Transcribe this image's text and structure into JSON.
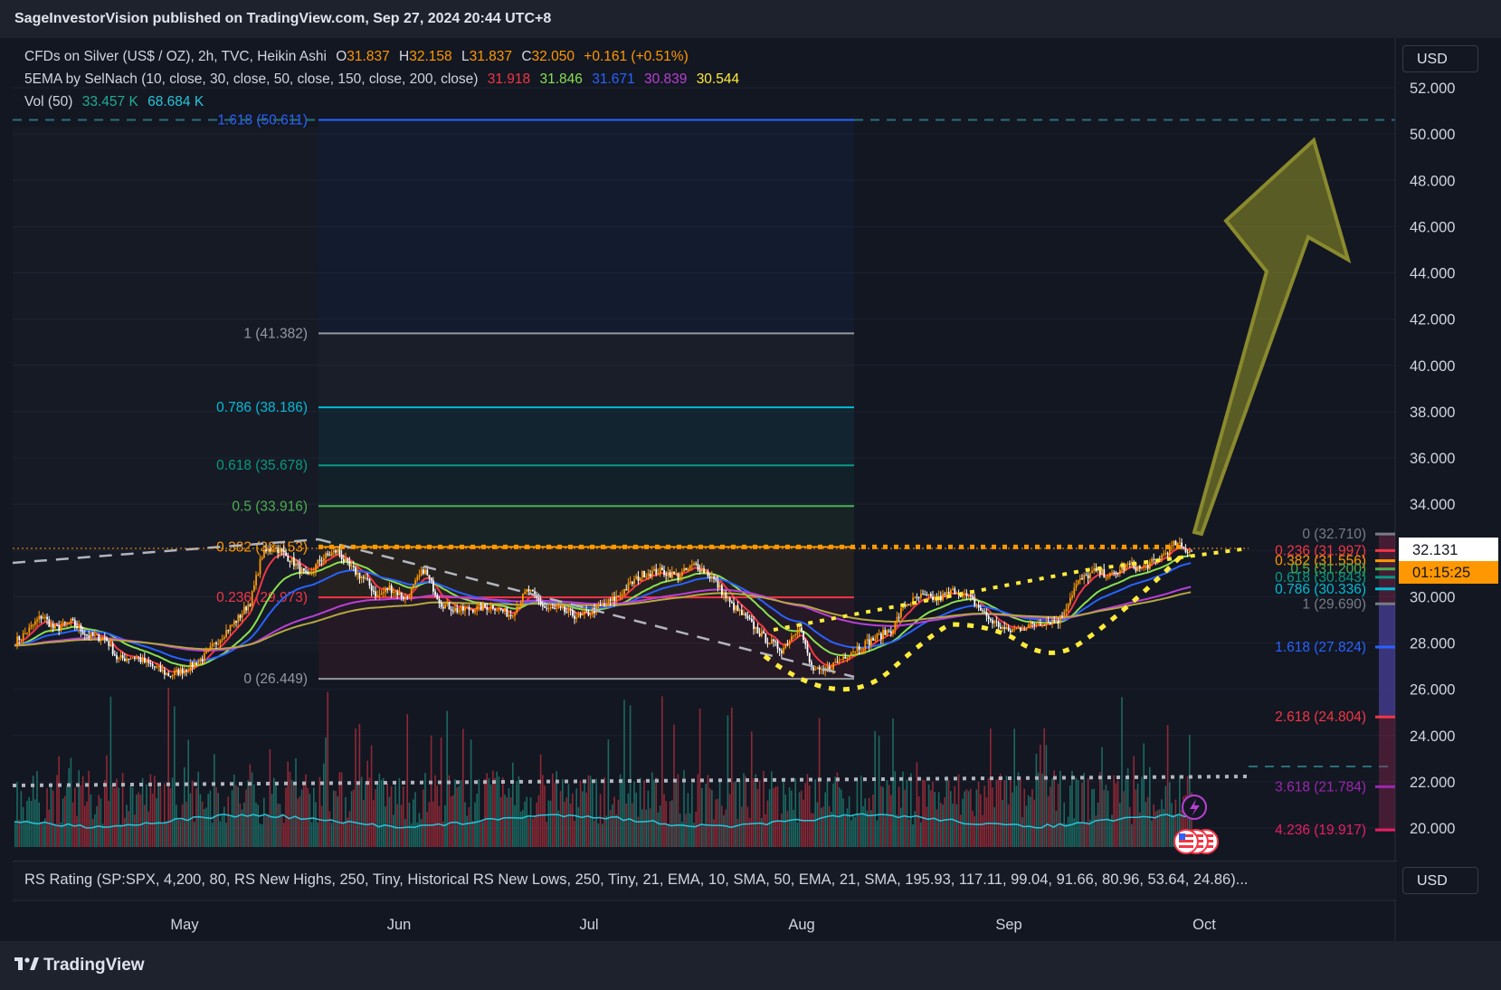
{
  "header": {
    "publisher": "SageInvestorVision published on TradingView.com, Sep 27, 2024 20:44 UTC+8"
  },
  "legend": {
    "symbol_line": "CFDs on Silver (US$ / OZ), 2h, TVC, Heikin Ashi",
    "ohlc": [
      {
        "label": "O",
        "value": "31.837"
      },
      {
        "label": "H",
        "value": "32.158"
      },
      {
        "label": "L",
        "value": "31.837"
      },
      {
        "label": "C",
        "value": "32.050"
      }
    ],
    "change": "+0.161 (+0.51%)",
    "ema_line": "5EMA by SelNach (10, close, 30, close, 50, close, 150, close, 200, close)",
    "ema_values": [
      {
        "value": "31.918",
        "color": "#f23645"
      },
      {
        "value": "31.846",
        "color": "#89e051"
      },
      {
        "value": "31.671",
        "color": "#2962ff"
      },
      {
        "value": "30.839",
        "color": "#ba3fd6"
      },
      {
        "value": "30.544",
        "color": "#ffeb3b"
      }
    ],
    "vol_line": "Vol (50)",
    "vol_values": [
      {
        "value": "33.457 K",
        "color": "#22ab94"
      },
      {
        "value": "68.684 K",
        "color": "#26c6da"
      }
    ]
  },
  "currency_top": "USD",
  "currency_bottom": "USD",
  "rs_rating": "RS Rating (SP:SPX, 4,200, 80, RS New Highs, 250, Tiny, Historical RS New Lows, 250, Tiny, 21, EMA, 10, SMA, 50, EMA, 21, SMA, 195.93, 117.11, 99.04, 91.66, 80.96, 53.64, 24.86)...",
  "footer": {
    "brand": "TradingView"
  },
  "colors": {
    "background": "#131722",
    "up": "#ff9800",
    "down": "#ffffff",
    "accent_arrow": "#8a8a2e"
  },
  "chart_data": {
    "type": "candlestick",
    "symbol": "CFDs on Silver (US$ / OZ)",
    "interval": "2h",
    "ylim": [
      19.2,
      53.2
    ],
    "y_ticks": [
      "52.000",
      "50.000",
      "48.000",
      "46.000",
      "44.000",
      "42.000",
      "40.000",
      "38.000",
      "36.000",
      "34.000",
      "32.000",
      "30.000",
      "28.000",
      "26.000",
      "24.000",
      "22.000",
      "20.000"
    ],
    "x_labels": [
      "May",
      "Jun",
      "Jul",
      "Aug",
      "Sep",
      "Oct"
    ],
    "price_path": [
      [
        "2024-04-24",
        27.8
      ],
      [
        "2024-04-27",
        28.4
      ],
      [
        "2024-04-30",
        29.2
      ],
      [
        "2024-05-02",
        28.6
      ],
      [
        "2024-05-05",
        28.9
      ],
      [
        "2024-05-08",
        28.3
      ],
      [
        "2024-05-11",
        28.2
      ],
      [
        "2024-05-13",
        27.3
      ],
      [
        "2024-05-16",
        27.4
      ],
      [
        "2024-05-19",
        27.0
      ],
      [
        "2024-05-22",
        26.6
      ],
      [
        "2024-05-25",
        26.9
      ],
      [
        "2024-05-28",
        27.4
      ],
      [
        "2024-05-31",
        28.3
      ],
      [
        "2024-06-03",
        29.1
      ],
      [
        "2024-06-05",
        29.8
      ],
      [
        "2024-06-07",
        31.8
      ],
      [
        "2024-06-09",
        32.2
      ],
      [
        "2024-06-12",
        31.6
      ],
      [
        "2024-06-15",
        30.8
      ],
      [
        "2024-06-17",
        31.6
      ],
      [
        "2024-06-20",
        32.0
      ],
      [
        "2024-06-22",
        31.3
      ],
      [
        "2024-06-25",
        30.7
      ],
      [
        "2024-06-27",
        30.0
      ],
      [
        "2024-06-29",
        30.4
      ],
      [
        "2024-07-02",
        29.9
      ],
      [
        "2024-07-05",
        31.2
      ],
      [
        "2024-07-08",
        29.7
      ],
      [
        "2024-07-11",
        29.4
      ],
      [
        "2024-07-14",
        29.5
      ],
      [
        "2024-07-17",
        29.6
      ],
      [
        "2024-07-20",
        29.2
      ],
      [
        "2024-07-23",
        30.3
      ],
      [
        "2024-07-26",
        29.5
      ],
      [
        "2024-07-29",
        29.4
      ],
      [
        "2024-08-01",
        29.1
      ],
      [
        "2024-08-04",
        29.5
      ],
      [
        "2024-08-07",
        29.9
      ],
      [
        "2024-08-10",
        30.6
      ],
      [
        "2024-08-12",
        31.0
      ],
      [
        "2024-08-15",
        31.1
      ],
      [
        "2024-08-18",
        30.9
      ],
      [
        "2024-08-21",
        31.4
      ],
      [
        "2024-08-24",
        30.8
      ],
      [
        "2024-08-27",
        29.7
      ],
      [
        "2024-08-30",
        29.0
      ],
      [
        "2024-09-02",
        28.2
      ],
      [
        "2024-09-05",
        27.7
      ],
      [
        "2024-09-08",
        28.8
      ],
      [
        "2024-09-10",
        26.9
      ],
      [
        "2024-09-12",
        26.7
      ],
      [
        "2024-09-15",
        27.3
      ],
      [
        "2024-09-18",
        27.8
      ],
      [
        "2024-09-21",
        28.2
      ],
      [
        "2024-09-24",
        28.6
      ],
      [
        "2024-09-26",
        29.6
      ],
      [
        "2024-09-29",
        30.0
      ],
      [
        "2024-10-02",
        29.9
      ],
      [
        "2024-10-05",
        30.3
      ],
      [
        "2024-10-08",
        29.8
      ],
      [
        "2024-10-11",
        29.0
      ],
      [
        "2024-10-14",
        28.5
      ],
      [
        "2024-10-17",
        28.7
      ],
      [
        "2024-10-20",
        28.9
      ],
      [
        "2024-10-23",
        29.0
      ],
      [
        "2024-10-26",
        30.6
      ],
      [
        "2024-10-29",
        31.1
      ],
      [
        "2024-11-01",
        30.9
      ],
      [
        "2024-11-04",
        31.4
      ],
      [
        "2024-11-06",
        31.2
      ],
      [
        "2024-11-09",
        31.6
      ],
      [
        "2024-11-12",
        32.3
      ],
      [
        "2024-11-14",
        32.0
      ]
    ],
    "fib_left": [
      {
        "label": "1.618 (50.611)",
        "price": 50.611,
        "color": "#2962ff"
      },
      {
        "label": "1 (41.382)",
        "price": 41.382,
        "color": "#9598a1"
      },
      {
        "label": "0.786 (38.186)",
        "price": 38.186,
        "color": "#00bcd4"
      },
      {
        "label": "0.618 (35.678)",
        "price": 35.678,
        "color": "#089981"
      },
      {
        "label": "0.5 (33.916)",
        "price": 33.916,
        "color": "#4caf50"
      },
      {
        "label": "0.382 (32.153)",
        "price": 32.153,
        "color": "#ff9800"
      },
      {
        "label": "0.236 (29.973)",
        "price": 29.973,
        "color": "#f23645"
      },
      {
        "label": "0 (26.449)",
        "price": 26.449,
        "color": "#9598a1"
      }
    ],
    "fib_right": [
      {
        "label": "0 (32.710)",
        "price": 32.71,
        "color": "#787b86"
      },
      {
        "label": "0.236 (31.997)",
        "price": 31.997,
        "color": "#f23645"
      },
      {
        "label": "0.382 (31.556)",
        "price": 31.556,
        "color": "#ff9800"
      },
      {
        "label": "0.5 (31.200)",
        "price": 31.2,
        "color": "#4caf50"
      },
      {
        "label": "0.618 (30.843)",
        "price": 30.843,
        "color": "#089981"
      },
      {
        "label": "0.786 (30.336)",
        "price": 30.336,
        "color": "#00bcd4"
      },
      {
        "label": "1 (29.690)",
        "price": 29.69,
        "color": "#787b86"
      },
      {
        "label": "1.618 (27.824)",
        "price": 27.824,
        "color": "#2962ff"
      },
      {
        "label": "2.618 (24.804)",
        "price": 24.804,
        "color": "#f23645"
      },
      {
        "label": "3.618 (21.784)",
        "price": 21.784,
        "color": "#9c27b0"
      },
      {
        "label": "4.236 (19.917)",
        "price": 19.917,
        "color": "#e91e63"
      }
    ],
    "last_price": "32.131",
    "countdown": "01:15:25"
  }
}
